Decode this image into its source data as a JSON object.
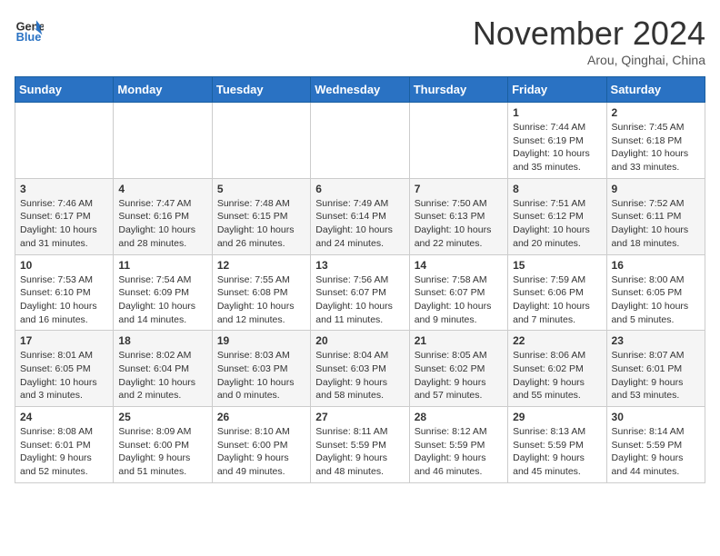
{
  "header": {
    "logo_line1": "General",
    "logo_line2": "Blue",
    "month": "November 2024",
    "location": "Arou, Qinghai, China"
  },
  "weekdays": [
    "Sunday",
    "Monday",
    "Tuesday",
    "Wednesday",
    "Thursday",
    "Friday",
    "Saturday"
  ],
  "weeks": [
    [
      {
        "day": "",
        "info": ""
      },
      {
        "day": "",
        "info": ""
      },
      {
        "day": "",
        "info": ""
      },
      {
        "day": "",
        "info": ""
      },
      {
        "day": "",
        "info": ""
      },
      {
        "day": "1",
        "info": "Sunrise: 7:44 AM\nSunset: 6:19 PM\nDaylight: 10 hours and 35 minutes."
      },
      {
        "day": "2",
        "info": "Sunrise: 7:45 AM\nSunset: 6:18 PM\nDaylight: 10 hours and 33 minutes."
      }
    ],
    [
      {
        "day": "3",
        "info": "Sunrise: 7:46 AM\nSunset: 6:17 PM\nDaylight: 10 hours and 31 minutes."
      },
      {
        "day": "4",
        "info": "Sunrise: 7:47 AM\nSunset: 6:16 PM\nDaylight: 10 hours and 28 minutes."
      },
      {
        "day": "5",
        "info": "Sunrise: 7:48 AM\nSunset: 6:15 PM\nDaylight: 10 hours and 26 minutes."
      },
      {
        "day": "6",
        "info": "Sunrise: 7:49 AM\nSunset: 6:14 PM\nDaylight: 10 hours and 24 minutes."
      },
      {
        "day": "7",
        "info": "Sunrise: 7:50 AM\nSunset: 6:13 PM\nDaylight: 10 hours and 22 minutes."
      },
      {
        "day": "8",
        "info": "Sunrise: 7:51 AM\nSunset: 6:12 PM\nDaylight: 10 hours and 20 minutes."
      },
      {
        "day": "9",
        "info": "Sunrise: 7:52 AM\nSunset: 6:11 PM\nDaylight: 10 hours and 18 minutes."
      }
    ],
    [
      {
        "day": "10",
        "info": "Sunrise: 7:53 AM\nSunset: 6:10 PM\nDaylight: 10 hours and 16 minutes."
      },
      {
        "day": "11",
        "info": "Sunrise: 7:54 AM\nSunset: 6:09 PM\nDaylight: 10 hours and 14 minutes."
      },
      {
        "day": "12",
        "info": "Sunrise: 7:55 AM\nSunset: 6:08 PM\nDaylight: 10 hours and 12 minutes."
      },
      {
        "day": "13",
        "info": "Sunrise: 7:56 AM\nSunset: 6:07 PM\nDaylight: 10 hours and 11 minutes."
      },
      {
        "day": "14",
        "info": "Sunrise: 7:58 AM\nSunset: 6:07 PM\nDaylight: 10 hours and 9 minutes."
      },
      {
        "day": "15",
        "info": "Sunrise: 7:59 AM\nSunset: 6:06 PM\nDaylight: 10 hours and 7 minutes."
      },
      {
        "day": "16",
        "info": "Sunrise: 8:00 AM\nSunset: 6:05 PM\nDaylight: 10 hours and 5 minutes."
      }
    ],
    [
      {
        "day": "17",
        "info": "Sunrise: 8:01 AM\nSunset: 6:05 PM\nDaylight: 10 hours and 3 minutes."
      },
      {
        "day": "18",
        "info": "Sunrise: 8:02 AM\nSunset: 6:04 PM\nDaylight: 10 hours and 2 minutes."
      },
      {
        "day": "19",
        "info": "Sunrise: 8:03 AM\nSunset: 6:03 PM\nDaylight: 10 hours and 0 minutes."
      },
      {
        "day": "20",
        "info": "Sunrise: 8:04 AM\nSunset: 6:03 PM\nDaylight: 9 hours and 58 minutes."
      },
      {
        "day": "21",
        "info": "Sunrise: 8:05 AM\nSunset: 6:02 PM\nDaylight: 9 hours and 57 minutes."
      },
      {
        "day": "22",
        "info": "Sunrise: 8:06 AM\nSunset: 6:02 PM\nDaylight: 9 hours and 55 minutes."
      },
      {
        "day": "23",
        "info": "Sunrise: 8:07 AM\nSunset: 6:01 PM\nDaylight: 9 hours and 53 minutes."
      }
    ],
    [
      {
        "day": "24",
        "info": "Sunrise: 8:08 AM\nSunset: 6:01 PM\nDaylight: 9 hours and 52 minutes."
      },
      {
        "day": "25",
        "info": "Sunrise: 8:09 AM\nSunset: 6:00 PM\nDaylight: 9 hours and 51 minutes."
      },
      {
        "day": "26",
        "info": "Sunrise: 8:10 AM\nSunset: 6:00 PM\nDaylight: 9 hours and 49 minutes."
      },
      {
        "day": "27",
        "info": "Sunrise: 8:11 AM\nSunset: 5:59 PM\nDaylight: 9 hours and 48 minutes."
      },
      {
        "day": "28",
        "info": "Sunrise: 8:12 AM\nSunset: 5:59 PM\nDaylight: 9 hours and 46 minutes."
      },
      {
        "day": "29",
        "info": "Sunrise: 8:13 AM\nSunset: 5:59 PM\nDaylight: 9 hours and 45 minutes."
      },
      {
        "day": "30",
        "info": "Sunrise: 8:14 AM\nSunset: 5:59 PM\nDaylight: 9 hours and 44 minutes."
      }
    ]
  ]
}
